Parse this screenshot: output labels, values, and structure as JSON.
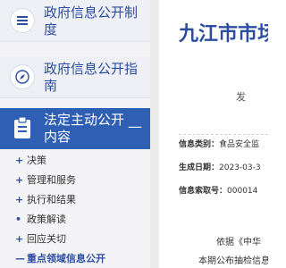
{
  "sidebar": {
    "nav": [
      {
        "label": "政府信息公开制度",
        "icon": "list-icon"
      },
      {
        "label": "政府信息公开指南",
        "icon": "compass-icon"
      }
    ],
    "active": {
      "label": "法定主动公开内容",
      "icon": "document-icon",
      "toggle": "—"
    },
    "sub_items": [
      {
        "mark": "+",
        "label": "决策"
      },
      {
        "mark": "+",
        "label": "管理和服务"
      },
      {
        "mark": "+",
        "label": "执行和结果"
      },
      {
        "mark": "•",
        "label": "政策解读"
      },
      {
        "mark": "+",
        "label": "回应关切"
      },
      {
        "mark": "—",
        "label": "重点领域信息公开"
      }
    ]
  },
  "main": {
    "title": "九江市市场",
    "fa_fragment": "发",
    "meta": {
      "category_label": "信息类别：",
      "category_value": "食品安全监",
      "date_label": "生成日期：",
      "date_value": "2023-03-3",
      "index_label": "信息索取号：",
      "index_value": "000014"
    },
    "body_line1": "依据《中华",
    "body_line2": "本期公布抽检信息"
  }
}
